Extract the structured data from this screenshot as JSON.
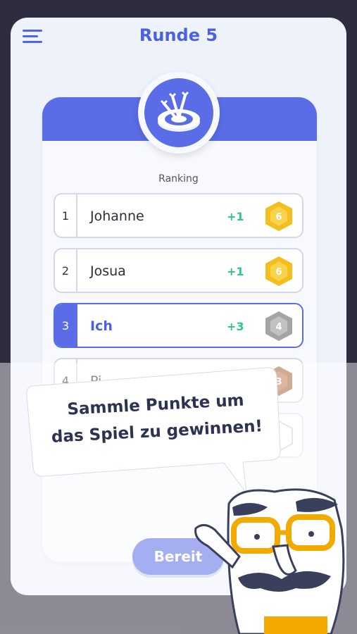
{
  "header": {
    "title": "Runde 5"
  },
  "ranking_label": "Ranking",
  "rows": [
    {
      "rank": "1",
      "name": "Johanne",
      "delta": "+1",
      "score": "6",
      "hex_color": "#f4be1d"
    },
    {
      "rank": "2",
      "name": "Josua",
      "delta": "+1",
      "score": "6",
      "hex_color": "#f4be1d"
    },
    {
      "rank": "3",
      "name": "Ich",
      "delta": "+3",
      "score": "4",
      "hex_color": "#a5a5a5"
    },
    {
      "rank": "4",
      "name": "Pi",
      "delta": "",
      "score": "3",
      "hex_color": "#a9673d"
    }
  ],
  "button": {
    "label": "Bereit"
  },
  "tooltip": {
    "line1": "Sammle Punkte um",
    "line2": "das Spiel zu gewinnen!"
  },
  "colors": {
    "accent": "#5a6de6",
    "positive": "#30c48f",
    "gold": "#f4be1d",
    "silver": "#a5a5a5",
    "bronze": "#a9673d"
  },
  "icons": {
    "menu": "hamburger-menu-icon",
    "badge": "darts-target-icon"
  }
}
